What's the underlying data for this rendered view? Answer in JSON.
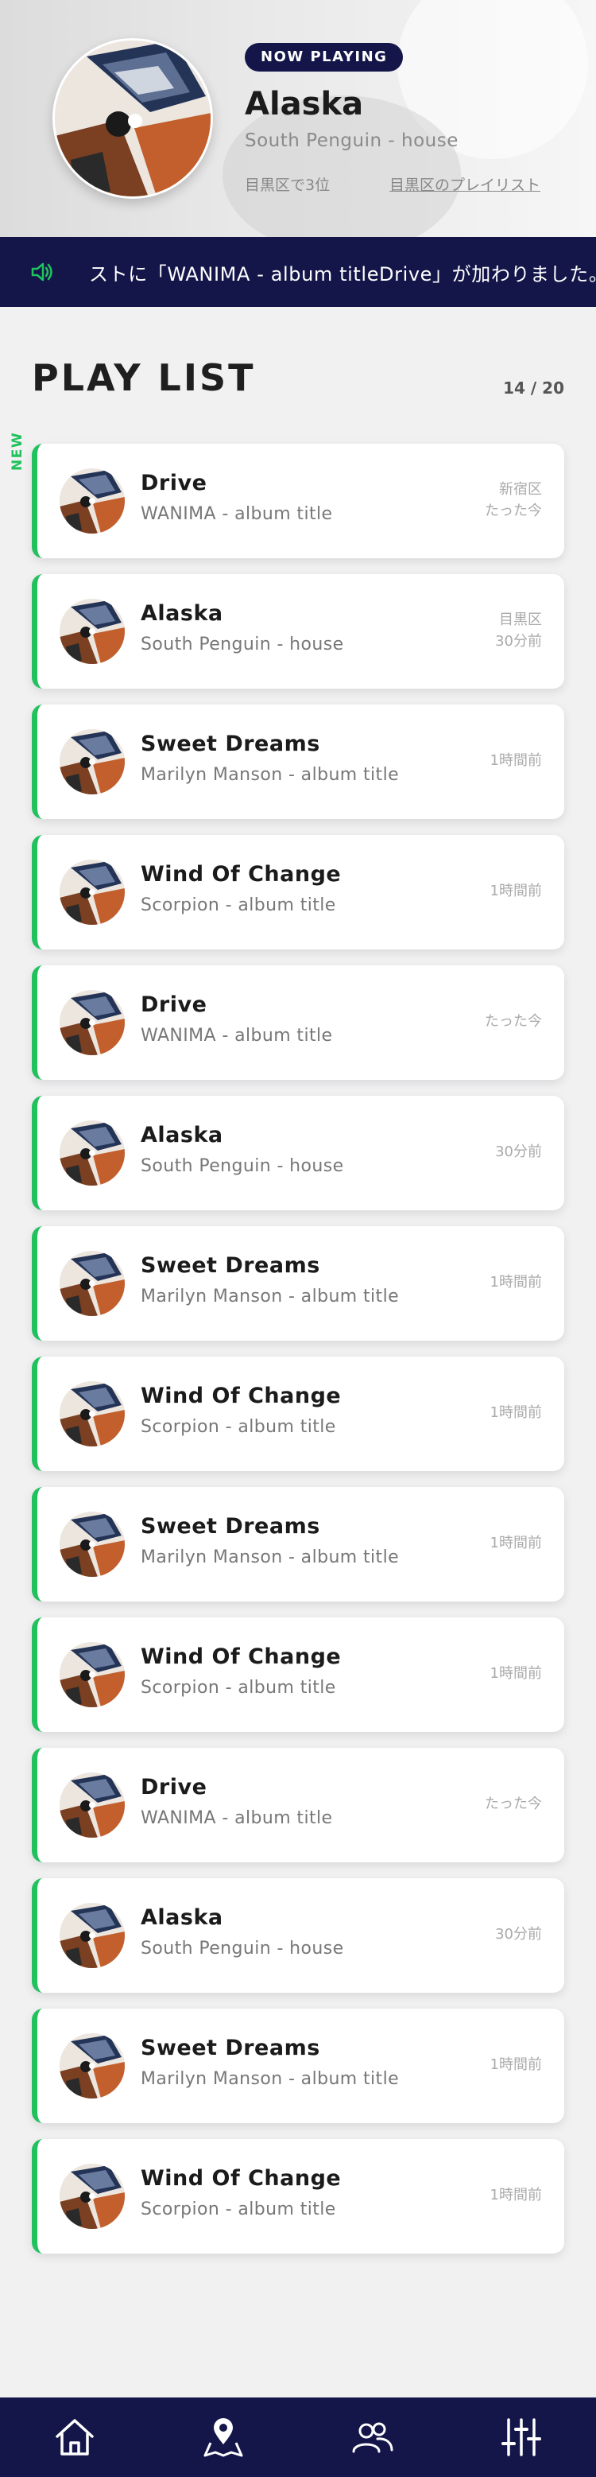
{
  "now_playing": {
    "badge": "NOW PLAYING",
    "title": "Alaska",
    "artist": "South Penguin - house",
    "rank": "目黒区で3位",
    "playlist_link": "目黒区のプレイリスト"
  },
  "ticker": {
    "icon": "speaker-icon",
    "message": "ストに「WANIMA - album titleDrive」が加わりました。"
  },
  "playlist": {
    "heading": "PLAY LIST",
    "count": "14 / 20",
    "new_label": "NEW",
    "items": [
      {
        "title": "Drive",
        "subtitle": "WANIMA - album title",
        "meta1": "新宿区",
        "meta2": "たった今"
      },
      {
        "title": "Alaska",
        "subtitle": "South Penguin - house",
        "meta1": "目黒区",
        "meta2": "30分前"
      },
      {
        "title": "Sweet Dreams",
        "subtitle": "Marilyn Manson - album title",
        "meta1": "",
        "meta2": "1時間前"
      },
      {
        "title": "Wind Of Change",
        "subtitle": "Scorpion - album title",
        "meta1": "",
        "meta2": "1時間前"
      },
      {
        "title": "Drive",
        "subtitle": "WANIMA - album title",
        "meta1": "",
        "meta2": "たった今"
      },
      {
        "title": "Alaska",
        "subtitle": "South Penguin - house",
        "meta1": "",
        "meta2": "30分前"
      },
      {
        "title": "Sweet Dreams",
        "subtitle": "Marilyn Manson - album title",
        "meta1": "",
        "meta2": "1時間前"
      },
      {
        "title": "Wind Of Change",
        "subtitle": "Scorpion - album title",
        "meta1": "",
        "meta2": "1時間前"
      },
      {
        "title": "Sweet Dreams",
        "subtitle": "Marilyn Manson - album title",
        "meta1": "",
        "meta2": "1時間前"
      },
      {
        "title": "Wind Of Change",
        "subtitle": "Scorpion - album title",
        "meta1": "",
        "meta2": "1時間前"
      },
      {
        "title": "Drive",
        "subtitle": "WANIMA - album title",
        "meta1": "",
        "meta2": "たった今"
      },
      {
        "title": "Alaska",
        "subtitle": "South Penguin - house",
        "meta1": "",
        "meta2": "30分前"
      },
      {
        "title": "Sweet Dreams",
        "subtitle": "Marilyn Manson - album title",
        "meta1": "",
        "meta2": "1時間前"
      },
      {
        "title": "Wind Of Change",
        "subtitle": "Scorpion - album title",
        "meta1": "",
        "meta2": "1時間前"
      }
    ]
  },
  "bottom_nav": [
    {
      "icon": "home-icon"
    },
    {
      "icon": "map-icon"
    },
    {
      "icon": "users-icon"
    },
    {
      "icon": "equalizer-icon"
    }
  ],
  "colors": {
    "navy": "#14164a",
    "accent_green": "#21c25e",
    "background": "#f1f1f2"
  }
}
